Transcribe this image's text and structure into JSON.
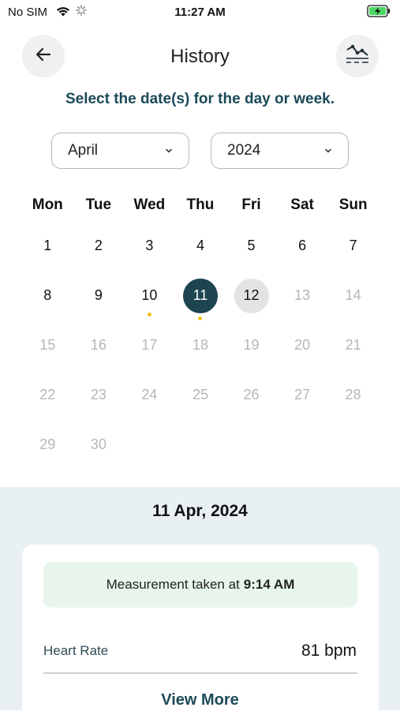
{
  "status_bar": {
    "carrier": "No SIM",
    "time": "11:27 AM",
    "battery_color": "#4cd964"
  },
  "header": {
    "title": "History",
    "back_icon": "arrow-left-icon",
    "graph_icon": "trend-graph-icon"
  },
  "prompt": "Select the date(s) for the day or week.",
  "selectors": {
    "month": "April",
    "year": "2024"
  },
  "calendar": {
    "weekdays": [
      "Mon",
      "Tue",
      "Wed",
      "Thu",
      "Fri",
      "Sat",
      "Sun"
    ],
    "weeks": [
      [
        "1",
        "2",
        "3",
        "4",
        "5",
        "6",
        "7"
      ],
      [
        "8",
        "9",
        "10",
        "11",
        "12",
        "13",
        "14"
      ],
      [
        "15",
        "16",
        "17",
        "18",
        "19",
        "20",
        "21"
      ],
      [
        "22",
        "23",
        "24",
        "25",
        "26",
        "27",
        "28"
      ],
      [
        "29",
        "30",
        "",
        "",
        "",
        "",
        ""
      ]
    ],
    "selected_day": "11",
    "today": "12",
    "last_available_day": "12",
    "days_with_measurements": [
      "10",
      "11"
    ],
    "accent_color": "#1c4451",
    "dot_color": "#f2c21a"
  },
  "details": {
    "date": "11 Apr, 2024",
    "measurement_prefix": "Measurement taken at",
    "measurement_time": "9:14 AM",
    "heart_rate_label": "Heart Rate",
    "heart_rate_value": "81 bpm",
    "view_more": "View More"
  }
}
